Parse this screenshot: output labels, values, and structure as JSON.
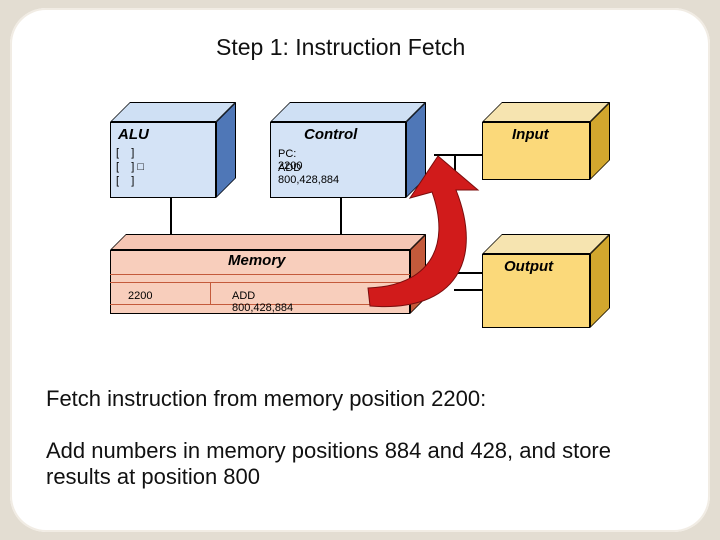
{
  "title": "Step 1: Instruction Fetch",
  "alu": {
    "label": "ALU",
    "lines": "[    ]\n[    ] □\n[    ]"
  },
  "control": {
    "label": "Control",
    "pc": "PC: 2200",
    "instr": "ADD 800,428,884"
  },
  "input": {
    "label": "Input"
  },
  "output": {
    "label": "Output"
  },
  "memory": {
    "label": "Memory",
    "addr": "2200",
    "instr": "ADD 800,428,884"
  },
  "desc1": "Fetch instruction from memory position 2200:",
  "desc2": "Add numbers in memory positions 884 and 428, and store results at position 800"
}
